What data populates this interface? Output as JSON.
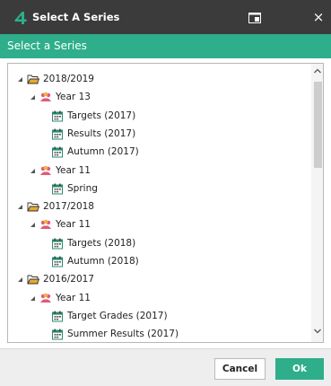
{
  "window": {
    "title": "Select A Series",
    "logo_text": "4",
    "close_glyph": "×",
    "icons": {
      "logo": "four-logo-icon",
      "popout": "popout-icon",
      "close": "close-icon"
    }
  },
  "header": {
    "title": "Select a Series"
  },
  "tree": {
    "icons": {
      "year": "folder-open-icon",
      "group": "student-group-icon",
      "series": "calendar-icon",
      "expanded": "triangle-expanded-icon"
    },
    "colors": {
      "folder": "#e6a92b",
      "group": "#e05a7a",
      "calendar": "#2b8a6f"
    },
    "rows": [
      {
        "label": "2018/2019",
        "kind": "year"
      },
      {
        "label": "Year 13",
        "kind": "group"
      },
      {
        "label": "Targets (2017)",
        "kind": "series"
      },
      {
        "label": "Results (2017)",
        "kind": "series"
      },
      {
        "label": "Autumn (2017)",
        "kind": "series"
      },
      {
        "label": "Year 11",
        "kind": "group"
      },
      {
        "label": "Spring",
        "kind": "series"
      },
      {
        "label": "2017/2018",
        "kind": "year"
      },
      {
        "label": "Year 11",
        "kind": "group"
      },
      {
        "label": "Targets (2018)",
        "kind": "series"
      },
      {
        "label": "Autumn (2018)",
        "kind": "series"
      },
      {
        "label": "2016/2017",
        "kind": "year"
      },
      {
        "label": "Year 11",
        "kind": "group"
      },
      {
        "label": "Target Grades (2017)",
        "kind": "series"
      },
      {
        "label": "Summer Results (2017)",
        "kind": "series"
      }
    ]
  },
  "footer": {
    "cancel_label": "Cancel",
    "ok_label": "Ok"
  },
  "colors": {
    "titlebar": "#3b3b3b",
    "accent": "#2eae8a"
  }
}
